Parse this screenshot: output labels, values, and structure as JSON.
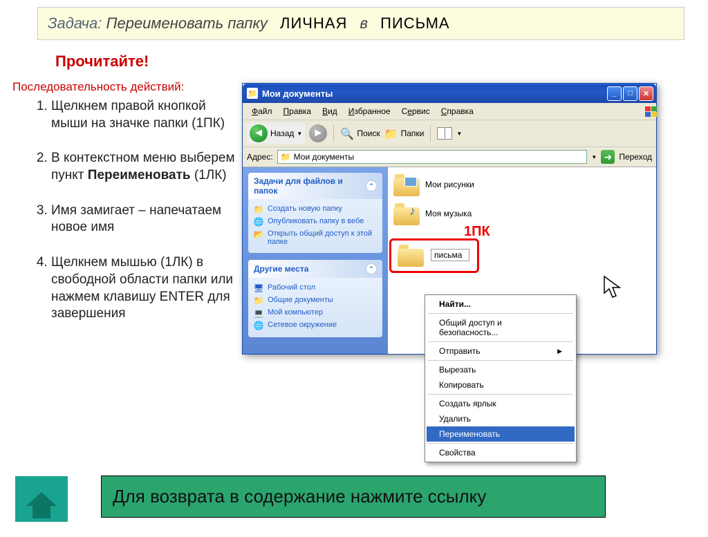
{
  "task": {
    "label": "Задача:",
    "text": "Переименовать папку",
    "from": "ЛИЧНАЯ",
    "mid": "в",
    "to": "ПИСЬМА"
  },
  "read": "Прочитайте!",
  "seq": "Последовательность действий:",
  "steps": {
    "s1a": "Щелкнем правой кнопкой мыши на значке папки (1ПК)",
    "s2a": "В контекстном меню выберем пункт ",
    "s2b": "Переименовать",
    "s2c": " (1ЛК)",
    "s3a": "Имя замигает – напечатаем новое имя",
    "s4a": "Щелкнем мышью (1ЛК) в свободной области папки или нажмем клавишу ENTER для завершения"
  },
  "window": {
    "title": "Мои документы",
    "menus": {
      "file": "Файл",
      "edit": "Правка",
      "view": "Вид",
      "fav": "Избранное",
      "tools": "Сервис",
      "help": "Справка"
    },
    "toolbar": {
      "back": "Назад",
      "search": "Поиск",
      "folders": "Папки"
    },
    "address": {
      "label": "Адрес:",
      "value": "Мои документы",
      "go": "Переход"
    },
    "sidepanel": {
      "box1": {
        "title": "Задачи для файлов и папок",
        "items": [
          "Создать новую папку",
          "Опубликовать папку в вебе",
          "Открыть общий доступ к этой папке"
        ]
      },
      "box2": {
        "title": "Другие места",
        "items": [
          "Рабочий стол",
          "Общие документы",
          "Мой компьютер",
          "Сетевое окружение"
        ]
      }
    },
    "content": {
      "pictures": "Мои рисунки",
      "music": "Моя музыка",
      "letters": "письма"
    },
    "highlight": "1ПК"
  },
  "contextmenu": {
    "find": "Найти...",
    "share": "Общий доступ и безопасность...",
    "send": "Отправить",
    "cut": "Вырезать",
    "copy": "Копировать",
    "shortcut": "Создать ярлык",
    "delete": "Удалить",
    "rename": "Переименовать",
    "props": "Свойства"
  },
  "return": "Для возврата в содержание нажмите ссылку"
}
